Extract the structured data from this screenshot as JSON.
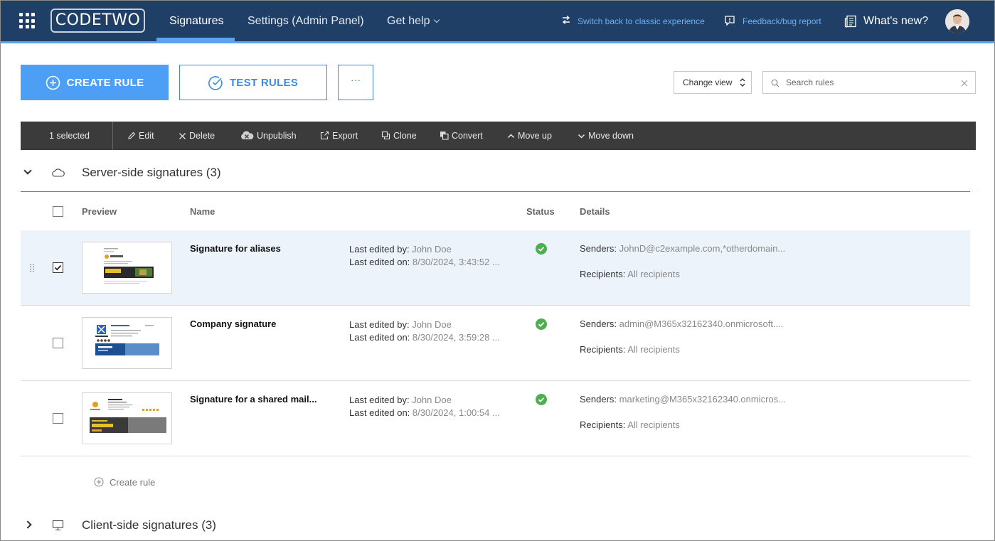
{
  "nav": {
    "brand": "CODETWO",
    "tabs": [
      {
        "label": "Signatures"
      },
      {
        "label": "Settings (Admin Panel)"
      },
      {
        "label": "Get help"
      }
    ],
    "switch_classic": "Switch back to classic experience",
    "feedback": "Feedback/bug report",
    "whats_new": "What's new?"
  },
  "actions": {
    "create_rule": "CREATE RULE",
    "test_rules": "TEST RULES",
    "more": "···",
    "change_view": "Change view",
    "search_placeholder": "Search rules"
  },
  "toolbar": {
    "selected": "1 selected",
    "items": [
      "Edit",
      "Delete",
      "Unpublish",
      "Export",
      "Clone",
      "Convert",
      "Move up",
      "Move down"
    ]
  },
  "groups": {
    "server": "Server-side signatures (3)",
    "client": "Client-side signatures (3)"
  },
  "columns": {
    "preview": "Preview",
    "name": "Name",
    "status": "Status",
    "details": "Details"
  },
  "labels": {
    "last_edited_by": "Last edited by:",
    "last_edited_on": "Last edited on:",
    "senders": "Senders:",
    "recipients": "Recipients:"
  },
  "rules": [
    {
      "name": "Signature for aliases",
      "edited_by": "John Doe",
      "edited_on": "8/30/2024, 3:43:52 ...",
      "senders": "JohnD@c2example.com,*otherdomain...",
      "recipients": "All recipients",
      "selected": true
    },
    {
      "name": "Company signature",
      "edited_by": "John Doe",
      "edited_on": "8/30/2024, 3:59:28 ...",
      "senders": "admin@M365x32162340.onmicrosoft....",
      "recipients": "All recipients",
      "selected": false
    },
    {
      "name": "Signature for a shared mail...",
      "edited_by": "John Doe",
      "edited_on": "8/30/2024, 1:00:54 ...",
      "senders": "marketing@M365x32162340.onmicros...",
      "recipients": "All recipients",
      "selected": false
    }
  ],
  "create_rule_link": "Create rule"
}
